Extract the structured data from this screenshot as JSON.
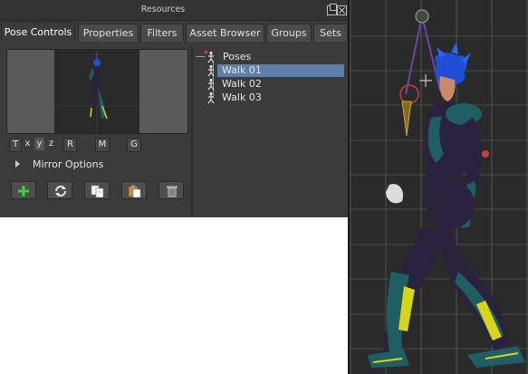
{
  "window": {
    "title": "Resources"
  },
  "tabs": [
    {
      "label": "Pose Controls",
      "active": true
    },
    {
      "label": "Properties",
      "active": false
    },
    {
      "label": "Filters",
      "active": false
    },
    {
      "label": "Asset Browser",
      "active": false
    },
    {
      "label": "Groups",
      "active": false
    },
    {
      "label": "Sets",
      "active": false
    }
  ],
  "axis_buttons": [
    "T",
    "x",
    "y",
    "z",
    "R",
    "M",
    "G"
  ],
  "mirror_options": {
    "label": "Mirror Options"
  },
  "actions": [
    {
      "icon": "add-icon"
    },
    {
      "icon": "refresh-icon"
    },
    {
      "icon": "copy-icon"
    },
    {
      "icon": "paste-icon"
    },
    {
      "icon": "trash-icon"
    }
  ],
  "tree": {
    "root": "Poses",
    "items": [
      {
        "label": "Walk 01",
        "selected": true
      },
      {
        "label": "Walk 02",
        "selected": false
      },
      {
        "label": "Walk 03",
        "selected": false
      }
    ]
  },
  "colors": {
    "panel_bg": "#3b3b3b",
    "selection": "#5d7fa8",
    "viewport_bg": "#2a2a2a",
    "character_hair": "#1f4fd6",
    "character_suit": "#2b2240",
    "character_armor": "#1f5f63",
    "accent_yellow": "#d8d41a"
  }
}
